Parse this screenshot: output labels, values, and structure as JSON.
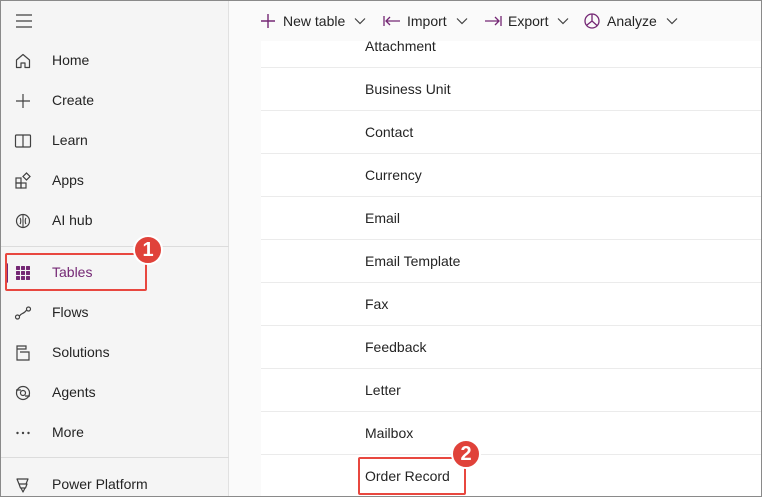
{
  "toolbar": {
    "new_table": "New table",
    "import": "Import",
    "export": "Export",
    "analyze": "Analyze"
  },
  "sidebar": {
    "items": [
      {
        "label": "Home",
        "icon": "home-icon"
      },
      {
        "label": "Create",
        "icon": "plus-icon"
      },
      {
        "label": "Learn",
        "icon": "book-icon"
      },
      {
        "label": "Apps",
        "icon": "apps-icon"
      },
      {
        "label": "AI hub",
        "icon": "brain-icon"
      },
      {
        "label": "Tables",
        "icon": "grid-icon",
        "active": true
      },
      {
        "label": "Flows",
        "icon": "flow-icon"
      },
      {
        "label": "Solutions",
        "icon": "solutions-icon"
      },
      {
        "label": "Agents",
        "icon": "agents-icon"
      },
      {
        "label": "More",
        "icon": "more-icon"
      },
      {
        "label": "Power Platform",
        "icon": "power-platform-icon"
      }
    ]
  },
  "tables": {
    "rows": [
      "Attachment",
      "Business Unit",
      "Contact",
      "Currency",
      "Email",
      "Email Template",
      "Fax",
      "Feedback",
      "Letter",
      "Mailbox",
      "Order Record"
    ]
  },
  "annotations": {
    "step1": "1",
    "step2": "2"
  },
  "colors": {
    "accent": "#742774",
    "callout": "#e0423a"
  }
}
